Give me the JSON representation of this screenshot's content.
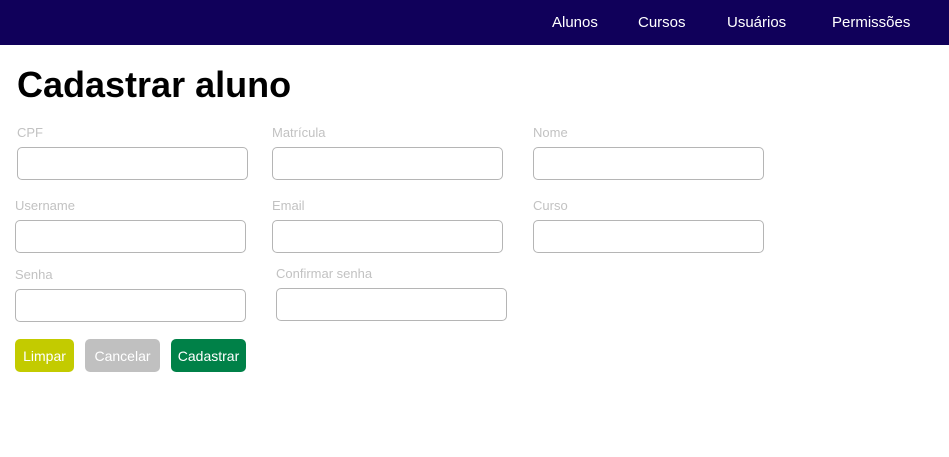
{
  "navbar": {
    "items": [
      {
        "label": "Alunos"
      },
      {
        "label": "Cursos"
      },
      {
        "label": "Usuários"
      },
      {
        "label": "Permissões"
      }
    ]
  },
  "page": {
    "title": "Cadastrar aluno"
  },
  "form": {
    "cpf": {
      "label": "CPF",
      "value": ""
    },
    "matricula": {
      "label": "Matrícula",
      "value": ""
    },
    "nome": {
      "label": "Nome",
      "value": ""
    },
    "username": {
      "label": "Username",
      "value": ""
    },
    "email": {
      "label": "Email",
      "value": ""
    },
    "curso": {
      "label": "Curso",
      "value": ""
    },
    "senha": {
      "label": "Senha",
      "value": ""
    },
    "confirmar_senha": {
      "label": "Confirmar senha",
      "value": ""
    }
  },
  "actions": {
    "limpar_label": "Limpar",
    "cancelar_label": "Cancelar",
    "cadastrar_label": "Cadastrar"
  },
  "colors": {
    "navbar_bg": "#10005a",
    "limpar_bg": "#c3cb00",
    "cancelar_bg": "#c0c0c0",
    "cadastrar_bg": "#008148",
    "label_text": "#c2c2c2",
    "input_border": "#b5b5b5"
  }
}
